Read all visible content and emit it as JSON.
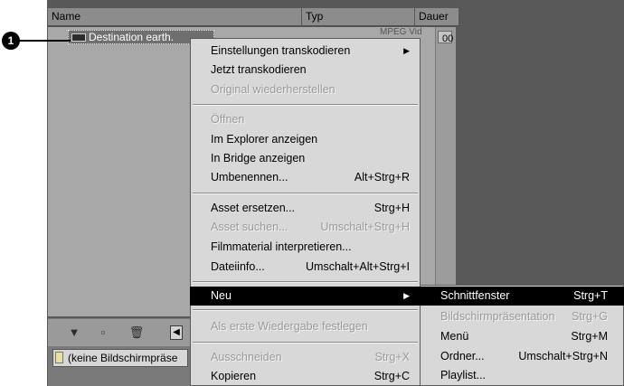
{
  "columns": {
    "name": "Name",
    "type": "Typ",
    "duration": "Dauer"
  },
  "row": {
    "name": "Destination earth.",
    "type": "MPEG Vid",
    "duration": "00"
  },
  "callout": "1",
  "preview_field": "(keine Bildschirmpräse",
  "menu": [
    {
      "label": "Einstellungen transkodieren",
      "shortcut": "",
      "submenu": true,
      "disabled": false
    },
    {
      "label": "Jetzt transkodieren",
      "shortcut": "",
      "disabled": false
    },
    {
      "label": "Original wiederherstellen",
      "shortcut": "",
      "disabled": true
    },
    {
      "label": "Öffnen",
      "shortcut": "",
      "disabled": true
    },
    {
      "label": "Im Explorer anzeigen",
      "shortcut": "",
      "disabled": false
    },
    {
      "label": "In Bridge anzeigen",
      "shortcut": "",
      "disabled": false
    },
    {
      "label": "Umbenennen...",
      "shortcut": "Alt+Strg+R",
      "disabled": false
    },
    {
      "label": "Asset ersetzen...",
      "shortcut": "Strg+H",
      "disabled": false
    },
    {
      "label": "Asset suchen...",
      "shortcut": "Umschalt+Strg+H",
      "disabled": true
    },
    {
      "label": "Filmmaterial interpretieren...",
      "shortcut": "",
      "disabled": false
    },
    {
      "label": "Dateiinfo...",
      "shortcut": "Umschalt+Alt+Strg+I",
      "disabled": false
    },
    {
      "label": "Neu",
      "shortcut": "",
      "submenu": true,
      "highlighted": true
    },
    {
      "label": "Als erste Wiedergabe festlegen",
      "shortcut": "",
      "disabled": true
    },
    {
      "label": "Ausschneiden",
      "shortcut": "Strg+X",
      "disabled": true
    },
    {
      "label": "Kopieren",
      "shortcut": "Strg+C",
      "disabled": false
    }
  ],
  "submenu": [
    {
      "label": "Schnittfenster",
      "shortcut": "Strg+T",
      "highlighted": true
    },
    {
      "label": "Bildschirmpräsentation",
      "shortcut": "Strg+G",
      "disabled": true
    },
    {
      "label": "Menü",
      "shortcut": "Strg+M"
    },
    {
      "label": "Ordner...",
      "shortcut": "Umschalt+Strg+N"
    },
    {
      "label": "Playlist...",
      "shortcut": ""
    }
  ],
  "submenu_arrow": "▶",
  "toolbar": {
    "filter_icon": "▼",
    "new_item_icon": "▫",
    "delete_icon": "🗑",
    "nav_left": "◀"
  }
}
